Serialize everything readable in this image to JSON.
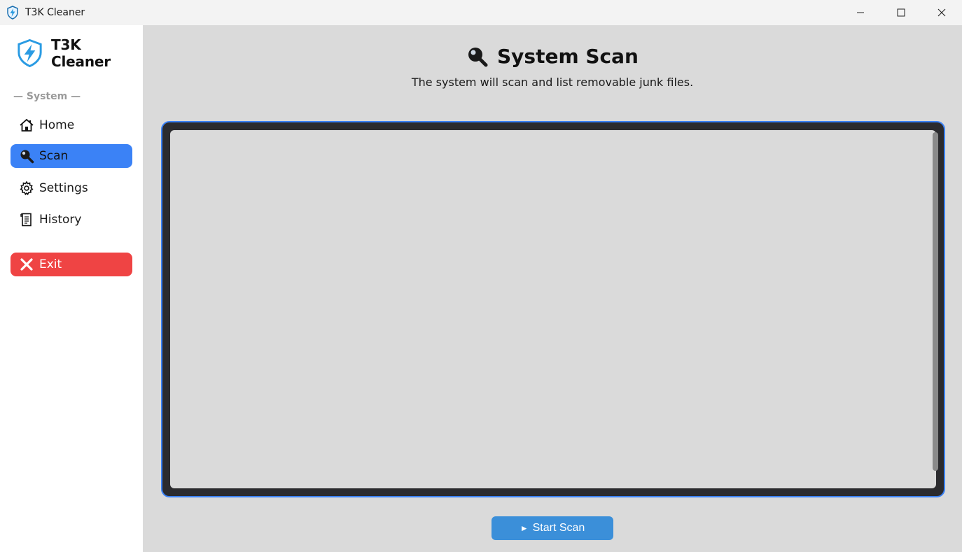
{
  "window": {
    "title": "T3K Cleaner",
    "controls": [
      "minimize-icon",
      "maximize-icon",
      "close-icon"
    ]
  },
  "sidebar": {
    "brand": "T3K Cleaner",
    "section_label": "— System —",
    "items": [
      {
        "label": "Home",
        "icon": "home-icon",
        "active": false
      },
      {
        "label": "Scan",
        "icon": "magnifier-icon",
        "active": true
      },
      {
        "label": "Settings",
        "icon": "gear-icon",
        "active": false
      },
      {
        "label": "History",
        "icon": "scroll-icon",
        "active": false
      }
    ],
    "exit_label": "Exit"
  },
  "main": {
    "title": "System Scan",
    "subtitle": "The system will scan and list removable junk files.",
    "start_label": "Start Scan",
    "start_icon": "play-triangle-icon"
  },
  "colors": {
    "accent": "#3b82f6",
    "exit": "#ef4444",
    "start_button": "#3b8fd9",
    "main_bg": "#dadada",
    "frame_bg": "#2b2b2e"
  }
}
